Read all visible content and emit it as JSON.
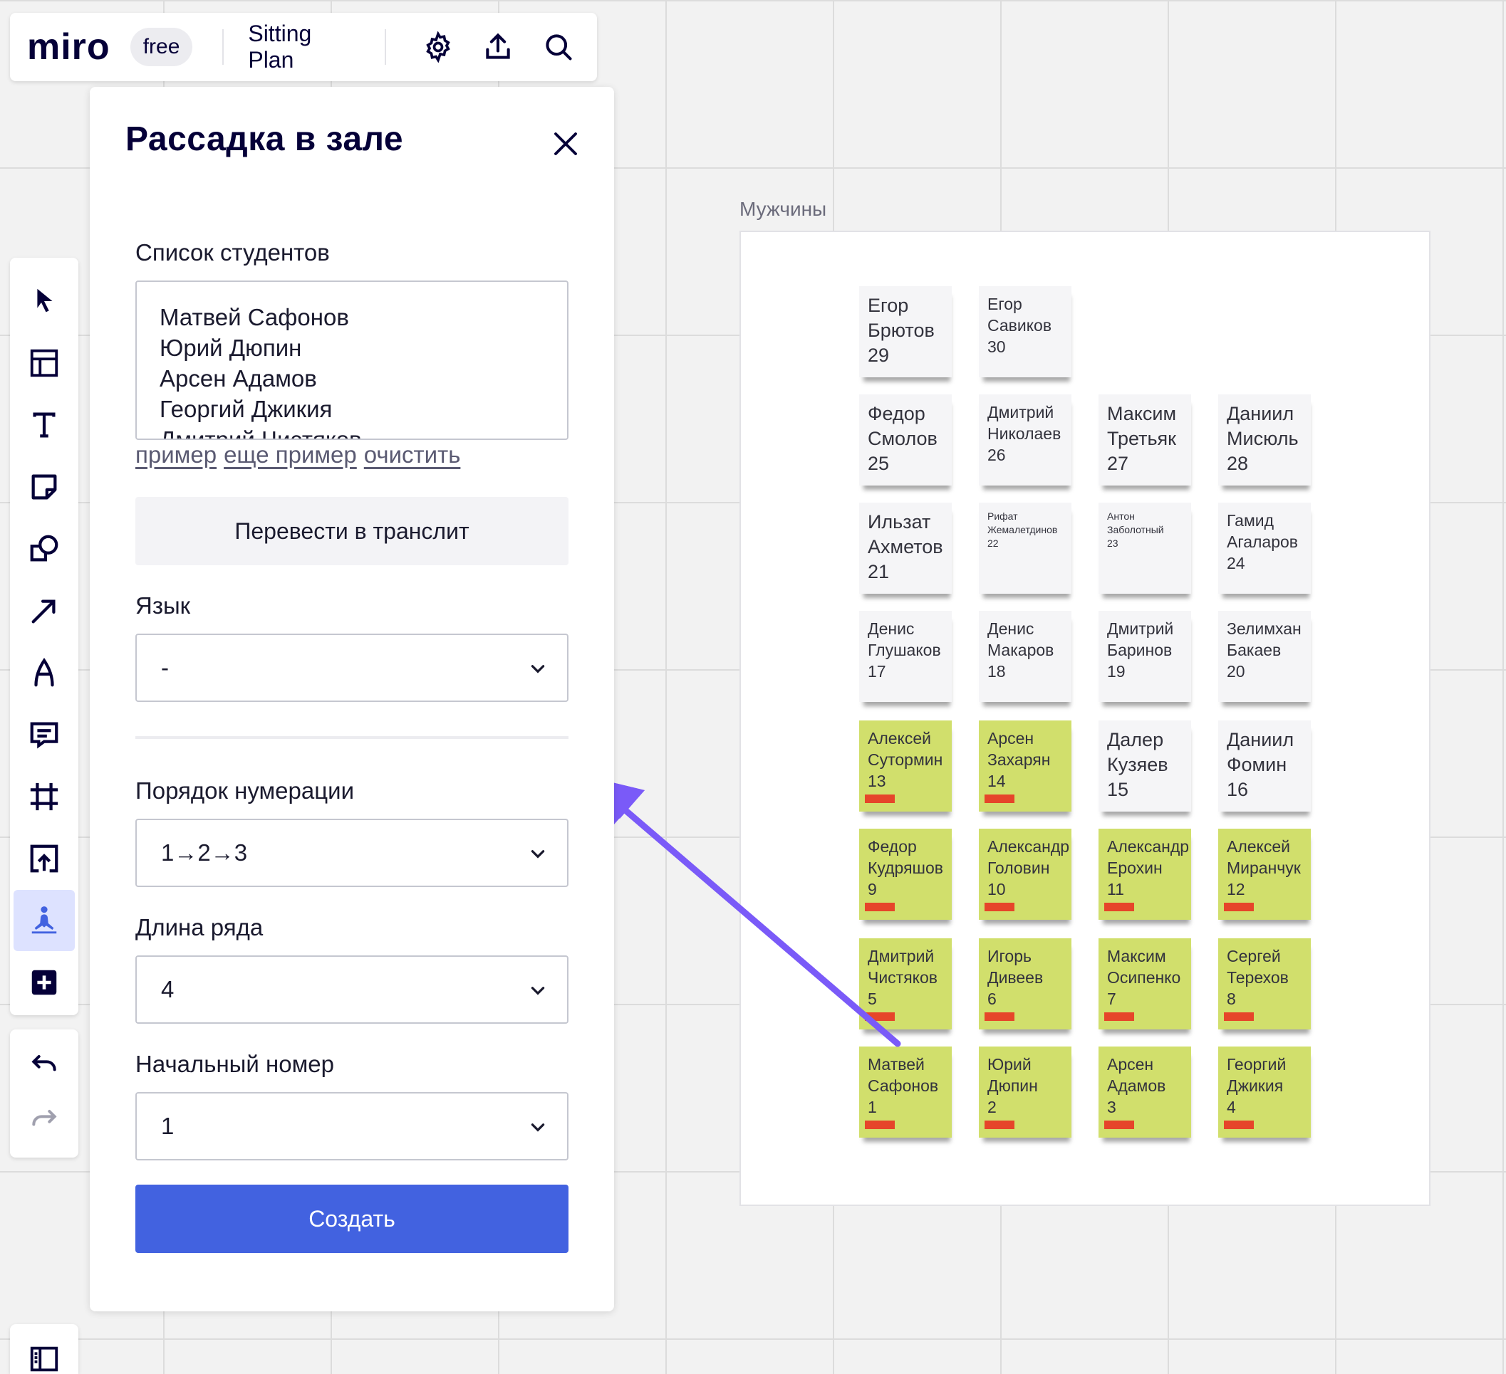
{
  "topbar": {
    "logo": "miro",
    "plan": "free",
    "board_title": "Sitting Plan",
    "icons": [
      "gear-icon",
      "upload-icon",
      "search-icon"
    ]
  },
  "toolbar": {
    "tools": [
      "select-cursor-icon",
      "templates-icon",
      "text-icon",
      "sticky-note-icon",
      "shapes-icon",
      "arrow-line-icon",
      "pen-icon",
      "comment-icon",
      "frame-icon",
      "upload-icon",
      "app-yoga-icon",
      "add-app-icon"
    ],
    "active_tool": "app-yoga-icon",
    "accent_color": "#4262e0"
  },
  "panel": {
    "title": "Рассадка в зале",
    "students_label": "Список студентов",
    "students_text": "Матвей Сафонов\nЮрий Дюпин\nАрсен Адамов\nГеоргий Джикия\nДмитрий Чистяков",
    "links": [
      "пример",
      "еще пример",
      "очистить"
    ],
    "translit_button": "Перевести в транслит",
    "language_label": "Язык",
    "language_value": "-",
    "numbering_label": "Порядок нумерации",
    "numbering_value": "1→2→3",
    "row_length_label": "Длина ряда",
    "row_length_value": "4",
    "start_number_label": "Начальный номер",
    "start_number_value": "1",
    "create_button": "Создать",
    "create_button_color": "#4262e0"
  },
  "frame": {
    "title": "Мужчины",
    "stickies": [
      {
        "first": "Егор",
        "last": "Брютов",
        "num": "29",
        "color": "white",
        "flag": false,
        "size": "l"
      },
      {
        "first": "Егор",
        "last": "Савиков",
        "num": "30",
        "color": "white",
        "flag": false,
        "size": "m"
      },
      {
        "first": "Федор",
        "last": "Смолов",
        "num": "25",
        "color": "white",
        "flag": false,
        "size": "l"
      },
      {
        "first": "Дмитрий",
        "last": "Николаев",
        "num": "26",
        "color": "white",
        "flag": false,
        "size": "m"
      },
      {
        "first": "Максим",
        "last": "Третьяк",
        "num": "27",
        "color": "white",
        "flag": false,
        "size": "l"
      },
      {
        "first": "Даниил",
        "last": "Мисюль",
        "num": "28",
        "color": "white",
        "flag": false,
        "size": "l"
      },
      {
        "first": "Ильзат",
        "last": "Ахметов",
        "num": "21",
        "color": "white",
        "flag": false,
        "size": "l"
      },
      {
        "first": "Рифат",
        "last": "Жемалетдинов",
        "num": "22",
        "color": "white",
        "flag": false,
        "size": "s"
      },
      {
        "first": "Антон",
        "last": "Заболотный",
        "num": "23",
        "color": "white",
        "flag": false,
        "size": "s"
      },
      {
        "first": "Гамид",
        "last": "Агаларов",
        "num": "24",
        "color": "white",
        "flag": false,
        "size": "m"
      },
      {
        "first": "Денис",
        "last": "Глушаков",
        "num": "17",
        "color": "white",
        "flag": false,
        "size": "m"
      },
      {
        "first": "Денис",
        "last": "Макаров",
        "num": "18",
        "color": "white",
        "flag": false,
        "size": "m"
      },
      {
        "first": "Дмитрий",
        "last": "Баринов",
        "num": "19",
        "color": "white",
        "flag": false,
        "size": "m"
      },
      {
        "first": "Зелимхан",
        "last": "Бакаев",
        "num": "20",
        "color": "white",
        "flag": false,
        "size": "m"
      },
      {
        "first": "Алексей",
        "last": "Сутормин",
        "num": "13",
        "color": "green",
        "flag": true,
        "size": "m"
      },
      {
        "first": "Арсен",
        "last": "Захарян",
        "num": "14",
        "color": "green",
        "flag": true,
        "size": "m"
      },
      {
        "first": "Далер",
        "last": "Кузяев",
        "num": "15",
        "color": "white",
        "flag": false,
        "size": "l"
      },
      {
        "first": "Даниил",
        "last": "Фомин",
        "num": "16",
        "color": "white",
        "flag": false,
        "size": "l"
      },
      {
        "first": "Федор",
        "last": "Кудряшов",
        "num": "9",
        "color": "green",
        "flag": true,
        "size": "m"
      },
      {
        "first": "Александр",
        "last": "Головин",
        "num": "10",
        "color": "green",
        "flag": true,
        "size": "m"
      },
      {
        "first": "Александр",
        "last": "Ерохин",
        "num": "11",
        "color": "green",
        "flag": true,
        "size": "m"
      },
      {
        "first": "Алексей",
        "last": "Миранчук",
        "num": "12",
        "color": "green",
        "flag": true,
        "size": "m"
      },
      {
        "first": "Дмитрий",
        "last": "Чистяков",
        "num": "5",
        "color": "green",
        "flag": true,
        "size": "m"
      },
      {
        "first": "Игорь",
        "last": "Дивеев",
        "num": "6",
        "color": "green",
        "flag": true,
        "size": "m"
      },
      {
        "first": "Максим",
        "last": "Осипенко",
        "num": "7",
        "color": "green",
        "flag": true,
        "size": "m"
      },
      {
        "first": "Сергей",
        "last": "Терехов",
        "num": "8",
        "color": "green",
        "flag": true,
        "size": "m"
      },
      {
        "first": "Матвей",
        "last": "Сафонов",
        "num": "1",
        "color": "green",
        "flag": true,
        "size": "m"
      },
      {
        "first": "Юрий",
        "last": "Дюпин",
        "num": "2",
        "color": "green",
        "flag": true,
        "size": "m"
      },
      {
        "first": "Арсен",
        "last": "Адамов",
        "num": "3",
        "color": "green",
        "flag": true,
        "size": "m"
      },
      {
        "first": "Георгий",
        "last": "Джикия",
        "num": "4",
        "color": "green",
        "flag": true,
        "size": "m"
      }
    ]
  },
  "colors": {
    "sticky_white": "#f5f5f7",
    "sticky_green": "#d1df6c",
    "flag_red": "#e6452a",
    "annotation_arrow": "#7a5af8"
  }
}
